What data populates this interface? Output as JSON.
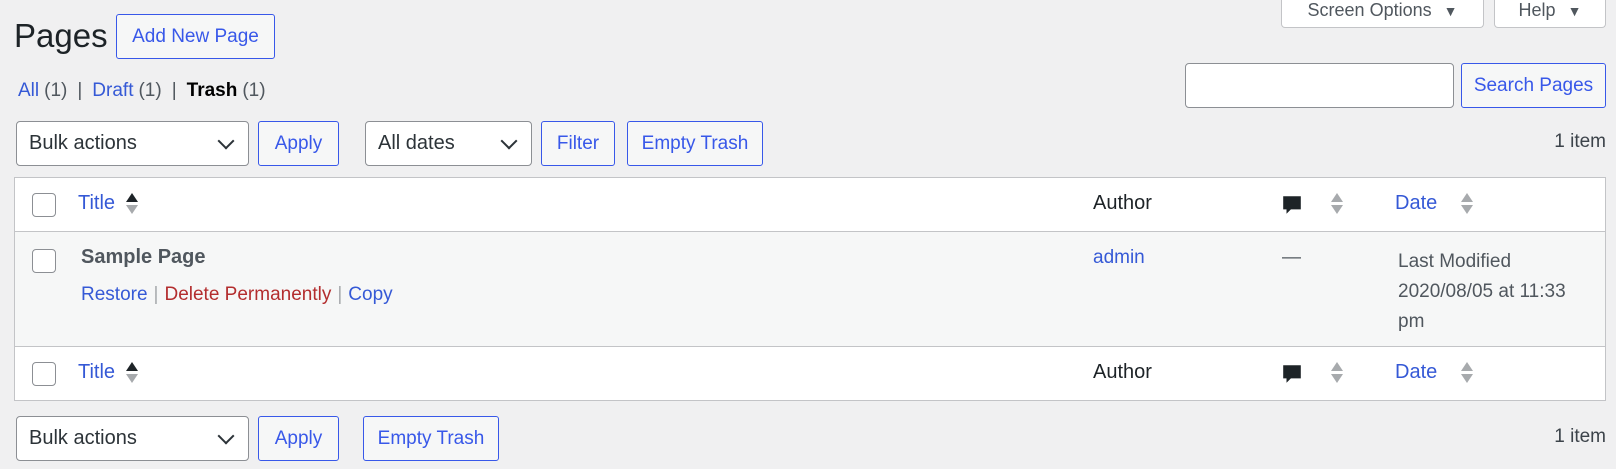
{
  "header": {
    "title": "Pages",
    "add_new_label": "Add New Page",
    "screen_options_label": "Screen Options",
    "help_label": "Help"
  },
  "views": [
    {
      "label": "All",
      "count": "(1)"
    },
    {
      "label": "Draft",
      "count": "(1)"
    },
    {
      "label": "Trash",
      "count": "(1)",
      "current": true
    }
  ],
  "search": {
    "value": "",
    "button_label": "Search Pages"
  },
  "top_nav": {
    "bulk_actions": "Bulk actions",
    "apply_label": "Apply",
    "dates": "All dates",
    "filter_label": "Filter",
    "empty_trash_label": "Empty Trash",
    "item_count": "1 item"
  },
  "bottom_nav": {
    "bulk_actions": "Bulk actions",
    "apply_label": "Apply",
    "empty_trash_label": "Empty Trash",
    "item_count": "1 item"
  },
  "columns": {
    "title": "Title",
    "author": "Author",
    "date": "Date"
  },
  "rows": [
    {
      "title": "Sample Page",
      "actions": {
        "restore": "Restore",
        "delete": "Delete Permanently",
        "copy": "Copy"
      },
      "author": "admin",
      "comments": "—",
      "date_line1": "Last Modified",
      "date_line2": "2020/08/05 at 11:33",
      "date_line3": "pm"
    }
  ],
  "icons": {
    "sort": "sort-arrows-icon",
    "comments": "comment-bubble-icon",
    "dropdown": "chevron-down-icon"
  },
  "colors": {
    "accent": "#3858e9",
    "delete": "#b32d2e",
    "background": "#f0f0f1"
  }
}
